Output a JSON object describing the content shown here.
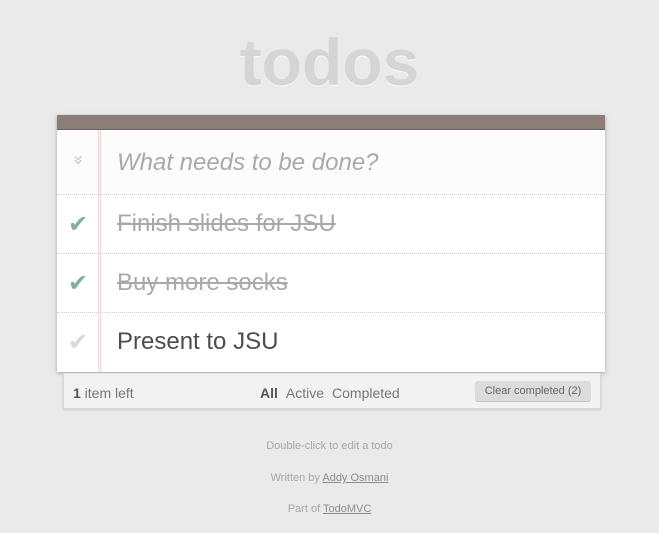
{
  "app": {
    "title": "todos"
  },
  "new_todo": {
    "placeholder": "What needs to be done?",
    "toggle_all_icon": "double-chevron-down-icon"
  },
  "todos": [
    {
      "text": "Finish slides for JSU",
      "completed": true
    },
    {
      "text": "Buy more socks",
      "completed": true
    },
    {
      "text": "Present to JSU",
      "completed": false
    }
  ],
  "footer": {
    "count_number": "1",
    "count_suffix": " item left",
    "filters": [
      {
        "label": "All",
        "selected": true
      },
      {
        "label": "Active",
        "selected": false
      },
      {
        "label": "Completed",
        "selected": false
      }
    ],
    "clear_label": "Clear completed (2)"
  },
  "info": {
    "hint": "Double-click to edit a todo",
    "written_prefix": "Written by ",
    "written_author": "Addy Osmani",
    "part_prefix": "Part of ",
    "part_link": "TodoMVC"
  },
  "colors": {
    "accent_check": "#85ada7",
    "topbar": "#8d7d77",
    "background": "#eaeaea"
  }
}
